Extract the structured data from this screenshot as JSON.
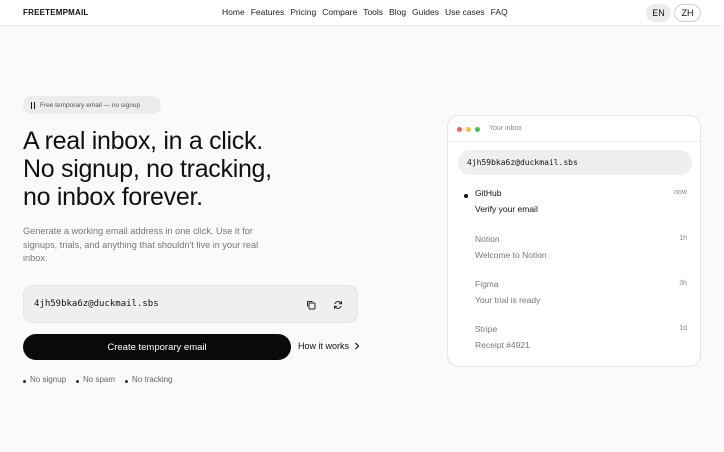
{
  "brand": "FREETEMPMAIL",
  "nav": [
    "Home",
    "Features",
    "Pricing",
    "Compare",
    "Tools",
    "Blog",
    "Guides",
    "Use cases",
    "FAQ"
  ],
  "lang": {
    "en": "EN",
    "zh": "ZH"
  },
  "badge": "Free temporary email — no signup",
  "headline": [
    "A real inbox, in a click.",
    "No signup, no tracking,",
    "no inbox forever."
  ],
  "subtext": "Generate a working email address in one click. Use it for signups, trials, and anything that shouldn't live in your real inbox.",
  "email": "4jh59bka6z@duckmail.sbs",
  "cta": "Create temporary email",
  "how_link": "How it works",
  "features": [
    "No signup",
    "No spam",
    "No tracking"
  ],
  "inbox": {
    "title": "Your inbox",
    "address": "4jh59bka6z@duckmail.sbs",
    "messages": [
      {
        "sender": "GitHub",
        "subject": "Verify your email",
        "time": "now",
        "unread": true
      },
      {
        "sender": "Notion",
        "subject": "Welcome to Notion",
        "time": "1h",
        "unread": false
      },
      {
        "sender": "Figma",
        "subject": "Your trial is ready",
        "time": "3h",
        "unread": false
      },
      {
        "sender": "Stripe",
        "subject": "Receipt #4921",
        "time": "1d",
        "unread": false
      }
    ]
  },
  "icons": {
    "copy": "copy-icon",
    "refresh": "refresh-icon",
    "chevron": "chevron-right-icon"
  }
}
